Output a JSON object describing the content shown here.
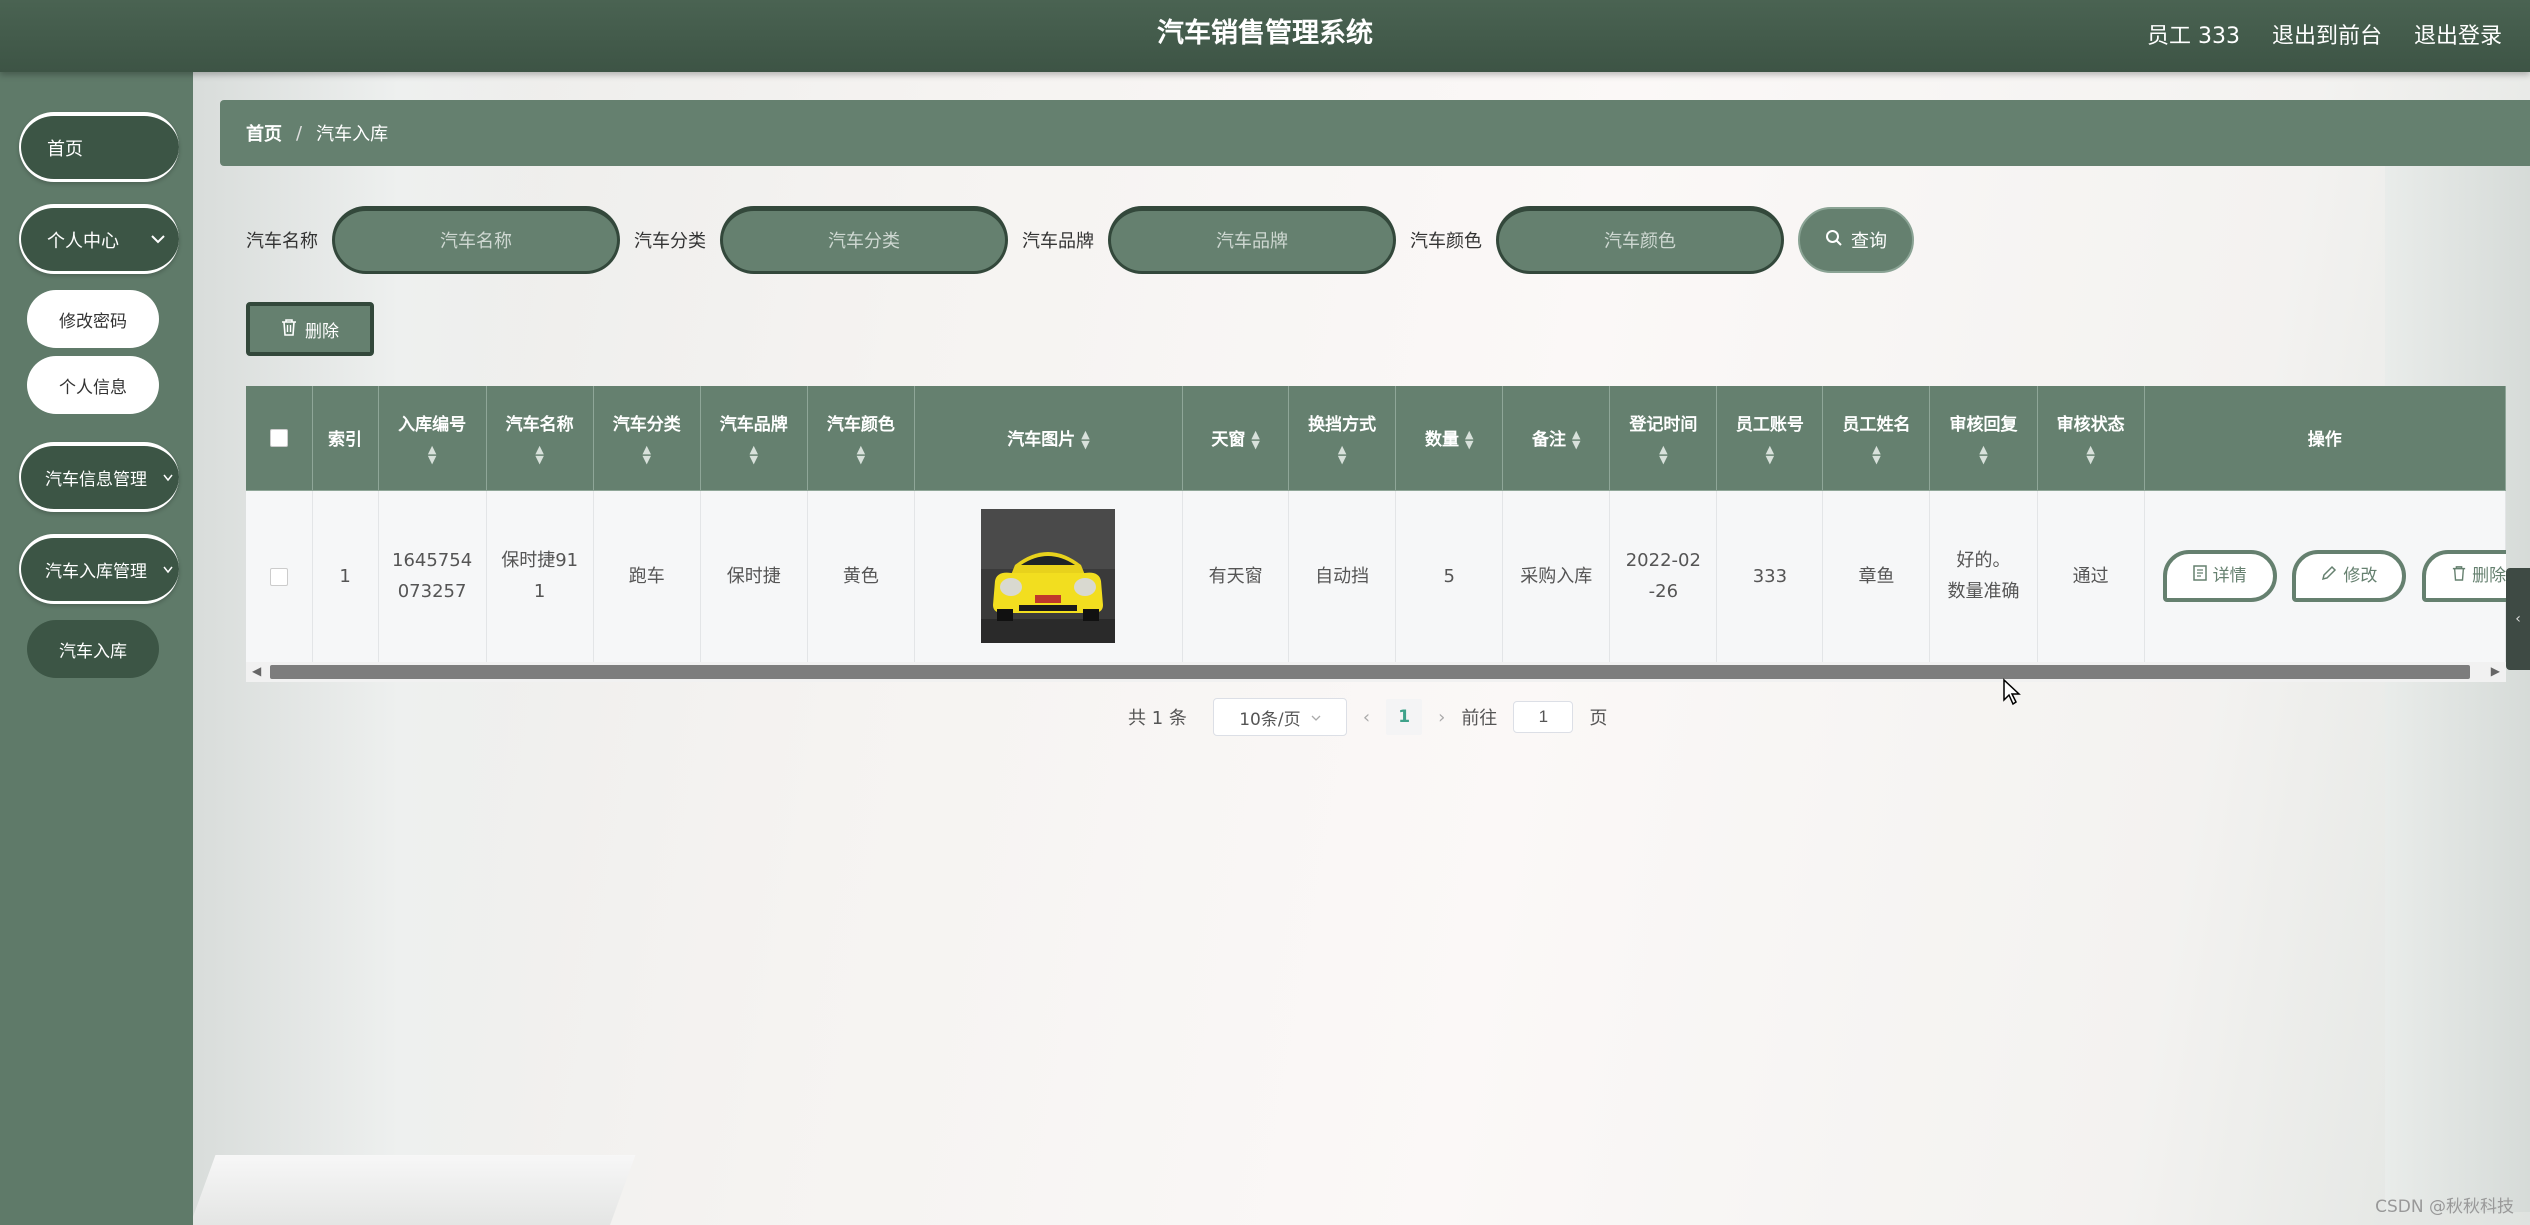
{
  "header": {
    "title": "汽车销售管理系统",
    "user": "员工 333",
    "to_front": "退出到前台",
    "logout": "退出登录"
  },
  "sidebar": {
    "home": "首页",
    "personal_center": "个人中心",
    "change_password": "修改密码",
    "personal_info": "个人信息",
    "car_info_mgmt": "汽车信息管理",
    "car_stock_mgmt": "汽车入库管理",
    "car_stock": "汽车入库"
  },
  "breadcrumb": {
    "home": "首页",
    "separator": "/",
    "current": "汽车入库"
  },
  "search": {
    "name_label": "汽车名称",
    "name_placeholder": "汽车名称",
    "category_label": "汽车分类",
    "category_placeholder": "汽车分类",
    "brand_label": "汽车品牌",
    "brand_placeholder": "汽车品牌",
    "color_label": "汽车颜色",
    "color_placeholder": "汽车颜色",
    "query_label": "查询"
  },
  "toolbar": {
    "delete_label": "删除"
  },
  "table": {
    "columns": [
      "索引",
      "入库编号",
      "汽车名称",
      "汽车分类",
      "汽车品牌",
      "汽车颜色",
      "汽车图片",
      "天窗",
      "换挡方式",
      "数量",
      "备注",
      "登记时间",
      "员工账号",
      "员工姓名",
      "审核回复",
      "审核状态",
      "操作"
    ],
    "rows": [
      {
        "index": "1",
        "stock_no_1": "1645754",
        "stock_no_2": "073257",
        "car_name_1": "保时捷91",
        "car_name_2": "1",
        "category": "跑车",
        "brand": "保时捷",
        "color": "黄色",
        "sunroof": "有天窗",
        "gearbox": "自动挡",
        "quantity": "5",
        "remark": "采购入库",
        "reg_time_1": "2022-02",
        "reg_time_2": "-26",
        "staff_account": "333",
        "staff_name": "章鱼",
        "review_reply_1": "好的。",
        "review_reply_2": "数量准确",
        "review_status": "通过"
      }
    ],
    "actions": {
      "detail": "详情",
      "edit": "修改",
      "delete": "删除"
    }
  },
  "pagination": {
    "total": "共 1 条",
    "page_size": "10条/页",
    "current_page": "1",
    "goto_prefix": "前往",
    "goto_value": "1",
    "goto_suffix": "页"
  },
  "watermark": "CSDN @秋秋科技",
  "colors": {
    "header": "#3d5445",
    "sidebar": "#5f7a69",
    "accent": "#65806f",
    "dark_green": "#33483b",
    "page_active": "#3fa28a"
  }
}
